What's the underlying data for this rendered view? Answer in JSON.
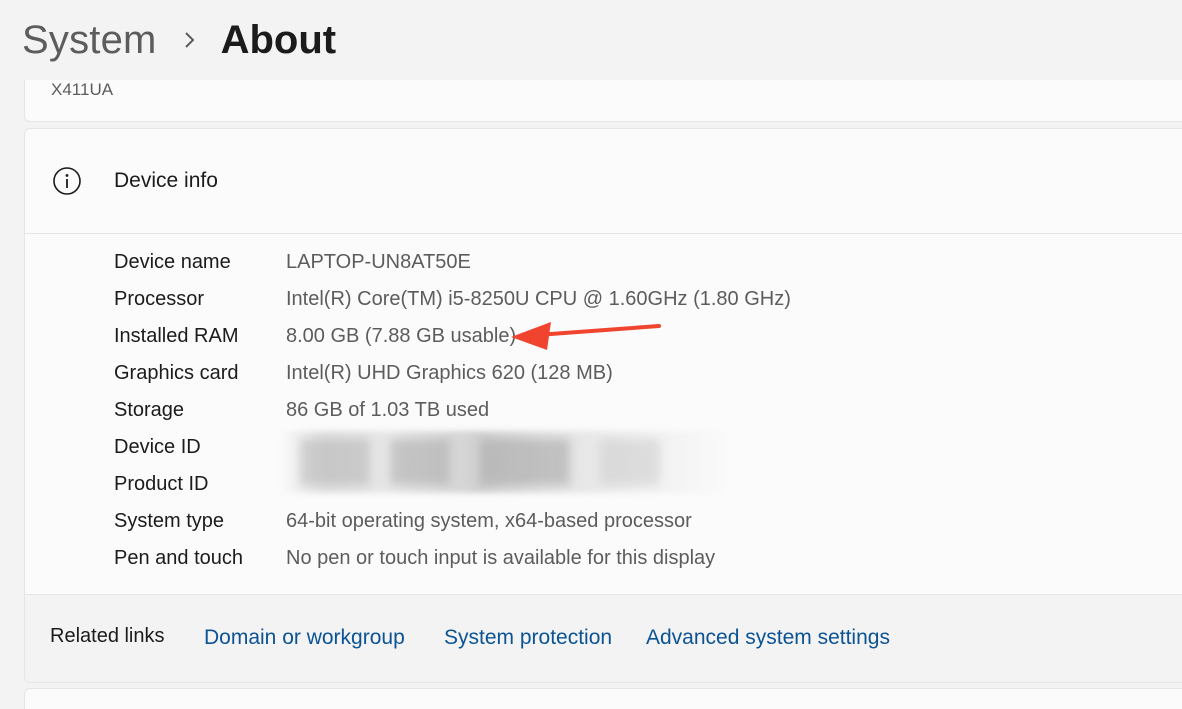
{
  "breadcrumb": {
    "parent": "System",
    "current": "About"
  },
  "device_model": "X411UA",
  "device_info": {
    "title": "Device info",
    "icon": "info-icon",
    "rows": [
      {
        "label": "Device name",
        "value": "LAPTOP-UN8AT50E"
      },
      {
        "label": "Processor",
        "value": "Intel(R) Core(TM) i5-8250U CPU @ 1.60GHz (1.80 GHz)"
      },
      {
        "label": "Installed RAM",
        "value": "8.00 GB (7.88 GB usable)"
      },
      {
        "label": "Graphics card",
        "value": "Intel(R) UHD Graphics 620 (128 MB)"
      },
      {
        "label": "Storage",
        "value": "86 GB of 1.03 TB used"
      },
      {
        "label": "Device ID",
        "value": ""
      },
      {
        "label": "Product ID",
        "value": ""
      },
      {
        "label": "System type",
        "value": "64-bit operating system, x64-based processor"
      },
      {
        "label": "Pen and touch",
        "value": "No pen or touch input is available for this display"
      }
    ]
  },
  "related_links": {
    "label": "Related links",
    "links": [
      "Domain or workgroup",
      "System protection",
      "Advanced system settings"
    ]
  },
  "colors": {
    "link": "#0b5394",
    "annotation_arrow": "#f0442f"
  }
}
